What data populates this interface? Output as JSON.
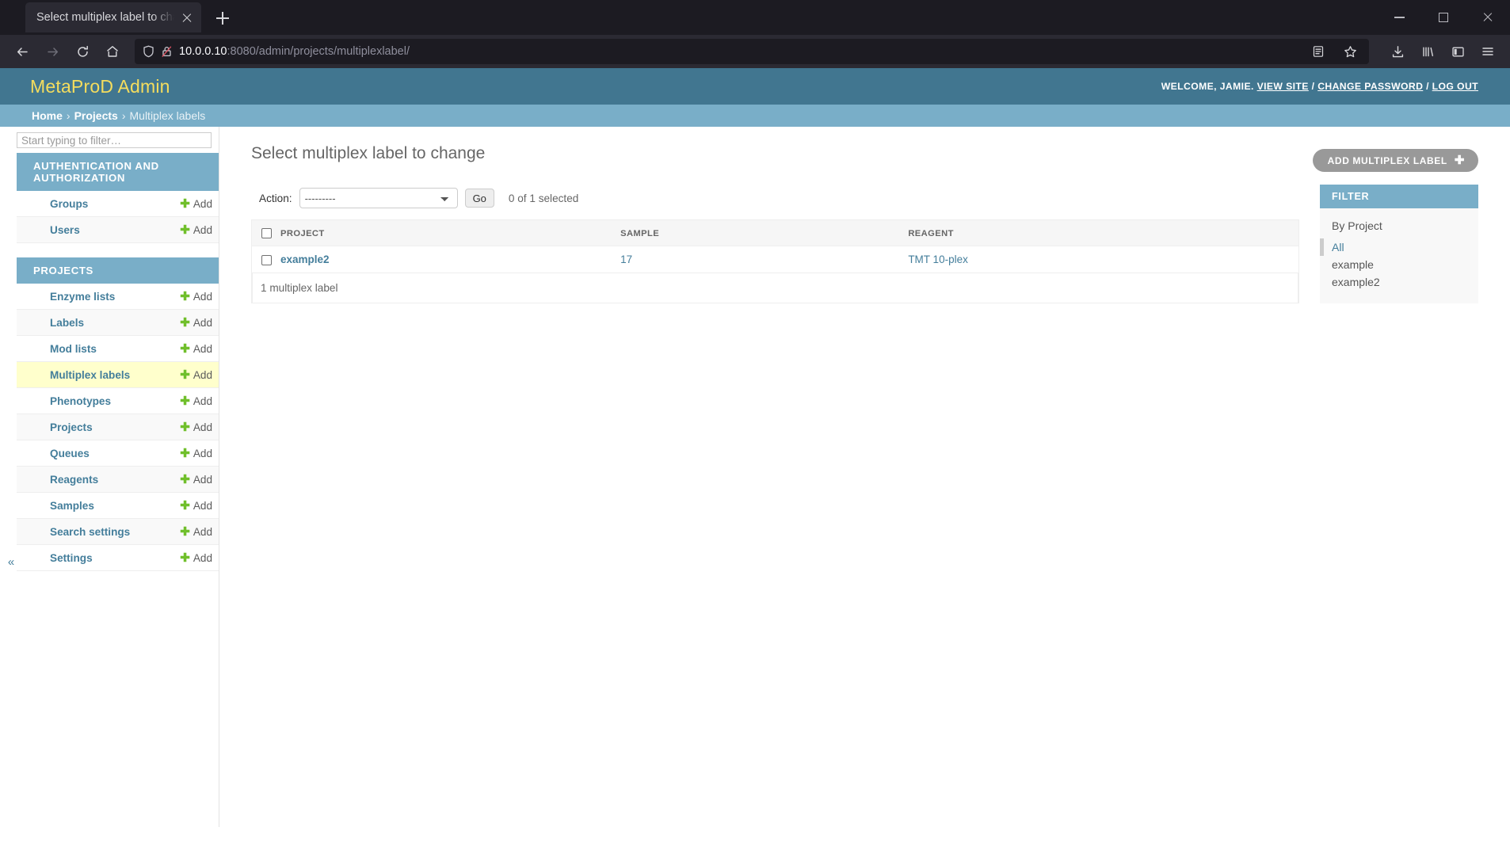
{
  "browser": {
    "tab_title": "Select multiplex label to change | M",
    "url_host": "10.0.0.10",
    "url_rest": ":8080/admin/projects/multiplexlabel/",
    "icons": {
      "back": "back-arrow-icon",
      "forward": "forward-arrow-icon",
      "reload": "reload-icon",
      "home": "home-icon",
      "shield": "shield-icon",
      "insecure": "insecure-lock-icon",
      "reader": "reader-view-icon",
      "bookmark": "bookmark-star-icon",
      "downloads": "downloads-icon",
      "library": "library-icon",
      "sidebar": "sidebar-icon",
      "menu": "hamburger-menu-icon"
    },
    "window": {
      "minimize": "minimize-icon",
      "maximize": "maximize-icon",
      "close": "close-icon"
    },
    "newtab_label": "+"
  },
  "colors": {
    "header_bg": "#417690",
    "branding": "#f5dd5d",
    "breadcrumb_bg": "#79aec8",
    "link": "#447e9b",
    "add_green": "#70bf2b",
    "current_row": "#ffffcc",
    "button_gray": "#999999"
  },
  "header": {
    "branding": "MetaProD Admin",
    "welcome": "WELCOME, JAMIE.",
    "view_site": "VIEW SITE",
    "sep1": "/",
    "change_password": "CHANGE PASSWORD",
    "sep2": "/",
    "log_out": "LOG OUT"
  },
  "breadcrumbs": {
    "home": "Home",
    "projects": "Projects",
    "current": "Multiplex labels"
  },
  "sidebar": {
    "filter_placeholder": "Start typing to filter…",
    "filter_value": "",
    "collapse_toggle": "«",
    "add_label": "Add",
    "apps": [
      {
        "caption": "AUTHENTICATION AND AUTHORIZATION",
        "models": [
          {
            "label": "Groups",
            "current": false
          },
          {
            "label": "Users",
            "current": false
          }
        ]
      },
      {
        "caption": "PROJECTS",
        "models": [
          {
            "label": "Enzyme lists",
            "current": false
          },
          {
            "label": "Labels",
            "current": false
          },
          {
            "label": "Mod lists",
            "current": false
          },
          {
            "label": "Multiplex labels",
            "current": true
          },
          {
            "label": "Phenotypes",
            "current": false
          },
          {
            "label": "Projects",
            "current": false
          },
          {
            "label": "Queues",
            "current": false
          },
          {
            "label": "Reagents",
            "current": false
          },
          {
            "label": "Samples",
            "current": false
          },
          {
            "label": "Search settings",
            "current": false
          },
          {
            "label": "Settings",
            "current": false
          }
        ]
      }
    ]
  },
  "main": {
    "title": "Select multiplex label to change",
    "add_button": "ADD MULTIPLEX LABEL",
    "add_button_plus": "✚",
    "action_label": "Action:",
    "action_selected": "---------",
    "action_options": [
      "---------"
    ],
    "go_button": "Go",
    "selection_counter": "0 of 1 selected",
    "table": {
      "columns": [
        "PROJECT",
        "SAMPLE",
        "REAGENT"
      ],
      "rows": [
        {
          "project": "example2",
          "sample": "17",
          "reagent": "TMT 10-plex"
        }
      ]
    },
    "paginator": "1 multiplex label"
  },
  "filter_panel": {
    "heading": "FILTER",
    "group_title": "By Project",
    "choices": [
      {
        "label": "All",
        "selected": true
      },
      {
        "label": "example",
        "selected": false
      },
      {
        "label": "example2",
        "selected": false
      }
    ]
  }
}
